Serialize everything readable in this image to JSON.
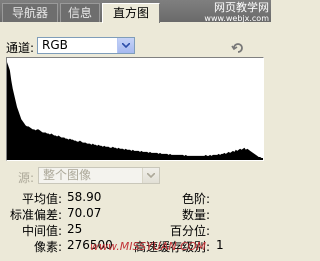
{
  "tabs": [
    {
      "label": "导航器",
      "active": false
    },
    {
      "label": "信息",
      "active": false
    },
    {
      "label": "直方图",
      "active": true
    }
  ],
  "watermark": {
    "top_line1": "网页教学网",
    "top_line2": "www.webjx.com",
    "bottom": "www.MISSYUAN.COM"
  },
  "channel": {
    "label": "通道:",
    "value": "RGB"
  },
  "source": {
    "label": "源:",
    "value": "整个图像",
    "disabled": true
  },
  "stats_left": [
    {
      "label": "平均值:",
      "value": "58.90"
    },
    {
      "label": "标准偏差:",
      "value": "70.07"
    },
    {
      "label": "中间值:",
      "value": "25"
    },
    {
      "label": "像素:",
      "value": "276500"
    }
  ],
  "stats_right": [
    {
      "label": "色阶:",
      "value": ""
    },
    {
      "label": "数量:",
      "value": ""
    },
    {
      "label": "百分位:",
      "value": ""
    },
    {
      "label": "高速缓存级别:",
      "value": "1"
    }
  ],
  "colors": {
    "panel_bg": "#ece9d8",
    "histogram_fill": "#000000",
    "tabbar_bg": "#6e6e6e"
  },
  "histogram_levels": [
    96,
    92,
    88,
    78,
    70,
    64,
    58,
    52,
    48,
    44,
    40,
    38,
    36,
    34,
    33,
    33,
    32,
    31,
    30,
    30,
    29,
    30,
    30,
    29,
    28,
    27,
    27,
    27,
    26,
    26,
    25,
    26,
    25,
    24,
    24,
    23,
    24,
    23,
    22,
    22,
    22,
    21,
    21,
    20,
    21,
    20,
    20,
    19,
    19,
    18,
    18,
    19,
    18,
    17,
    17,
    17,
    16,
    16,
    16,
    15,
    16,
    15,
    15,
    14,
    15,
    14,
    14,
    13,
    14,
    13,
    13,
    13,
    12,
    12,
    13,
    12,
    12,
    11,
    12,
    11,
    11,
    11,
    10,
    11,
    10,
    10,
    10,
    9,
    10,
    9,
    9,
    9,
    9,
    8,
    9,
    8,
    8,
    8,
    8,
    7,
    8,
    7,
    7,
    7,
    7,
    7,
    6,
    7,
    6,
    6,
    6,
    6,
    6,
    5,
    6,
    5,
    5,
    5,
    5,
    5,
    5,
    5,
    5,
    5,
    4,
    5,
    4,
    4,
    4,
    4,
    4,
    4,
    4,
    4,
    4,
    4,
    4,
    4,
    4,
    5,
    4,
    4,
    5,
    4,
    5,
    5,
    5,
    5,
    6,
    5,
    6,
    6,
    7,
    6,
    7,
    8,
    7,
    8,
    9,
    8,
    10,
    9,
    10,
    11,
    10,
    11,
    12,
    10,
    11,
    10,
    9,
    8,
    7,
    6,
    5,
    4,
    3,
    3,
    2,
    2
  ]
}
